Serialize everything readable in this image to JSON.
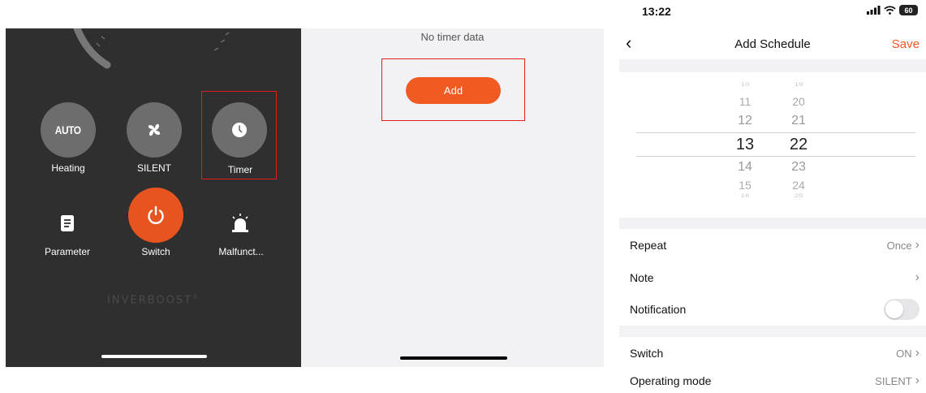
{
  "control_panel": {
    "buttons": [
      {
        "label": "Heating",
        "icon": "auto-icon",
        "icon_text": "AUTO"
      },
      {
        "label": "SILENT",
        "icon": "fan-icon"
      },
      {
        "label": "Timer",
        "icon": "clock-icon"
      },
      {
        "label": "Parameter",
        "icon": "document-icon"
      },
      {
        "label": "Switch",
        "icon": "power-icon"
      },
      {
        "label": "Malfunct...",
        "icon": "alarm-icon"
      }
    ],
    "brand": "INVERBOOST",
    "brand_mark": "®",
    "accent_color": "#e8541f"
  },
  "timer_panel": {
    "empty_text": "No timer data",
    "add_label": "Add",
    "accent_color": "#f25a24"
  },
  "schedule_panel": {
    "status_bar": {
      "time": "13:22",
      "battery": "60"
    },
    "nav": {
      "back_icon": "chevron-left-icon",
      "title": "Add Schedule",
      "save_label": "Save"
    },
    "picker": {
      "hours": [
        "10",
        "11",
        "12",
        "13",
        "14",
        "15",
        "16"
      ],
      "minutes": [
        "19",
        "20",
        "21",
        "22",
        "23",
        "24",
        "25"
      ],
      "selected_hour": "13",
      "selected_minute": "22"
    },
    "rows": {
      "repeat": {
        "label": "Repeat",
        "value": "Once"
      },
      "note": {
        "label": "Note",
        "value": ""
      },
      "notification": {
        "label": "Notification",
        "enabled": false
      },
      "switch": {
        "label": "Switch",
        "value": "ON"
      },
      "mode": {
        "label": "Operating mode",
        "value": "SILENT"
      }
    }
  }
}
